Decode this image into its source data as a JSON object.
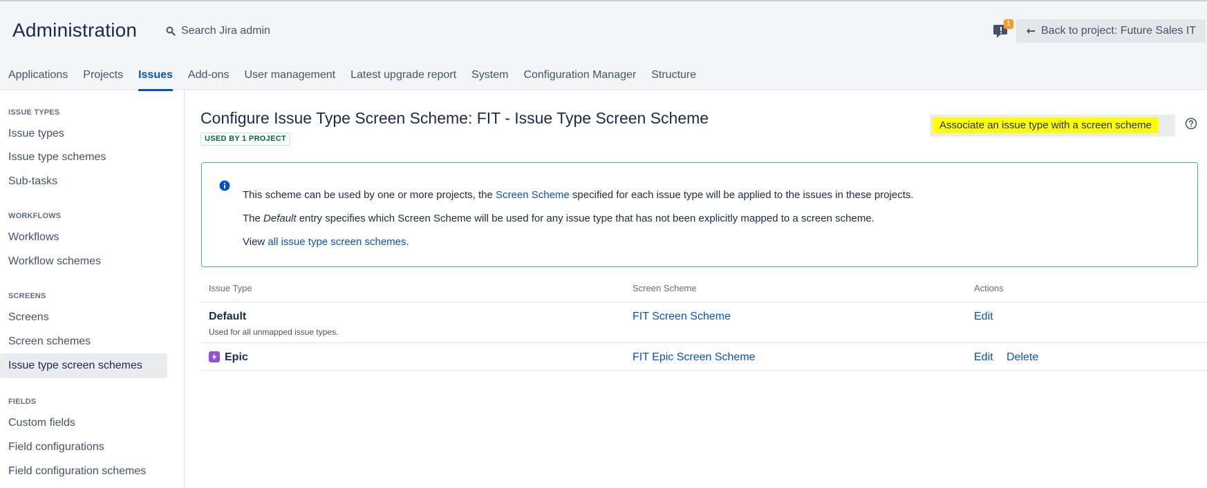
{
  "header": {
    "title": "Administration",
    "search_placeholder": "Search Jira admin",
    "notification_count": "1",
    "back_button_label": "Back to project: Future Sales IT"
  },
  "nav": {
    "tabs": [
      "Applications",
      "Projects",
      "Issues",
      "Add-ons",
      "User management",
      "Latest upgrade report",
      "System",
      "Configuration Manager",
      "Structure"
    ],
    "active": "Issues"
  },
  "sidebar": {
    "sections": [
      {
        "heading": "ISSUE TYPES",
        "items": [
          "Issue types",
          "Issue type schemes",
          "Sub-tasks"
        ]
      },
      {
        "heading": "WORKFLOWS",
        "items": [
          "Workflows",
          "Workflow schemes"
        ]
      },
      {
        "heading": "SCREENS",
        "items": [
          "Screens",
          "Screen schemes",
          "Issue type screen schemes"
        ]
      },
      {
        "heading": "FIELDS",
        "items": [
          "Custom fields",
          "Field configurations",
          "Field configuration schemes"
        ]
      }
    ],
    "selected": "Issue type screen schemes"
  },
  "main": {
    "title": "Configure Issue Type Screen Scheme: FIT - Issue Type Screen Scheme",
    "used_by_lozenge": "USED BY 1 PROJECT",
    "associate_button": "Associate an issue type with a screen scheme",
    "info": {
      "line1_before": "This scheme can be used by one or more projects, the ",
      "line1_link": "Screen Scheme",
      "line1_after": " specified for each issue type will be applied to the issues in these projects.",
      "line2_before": "The ",
      "line2_italic": "Default",
      "line2_after": " entry specifies which Screen Scheme will be used for any issue type that has not been explicitly mapped to a screen scheme.",
      "line3_before": "View ",
      "line3_link": "all issue type screen schemes",
      "line3_after": "."
    },
    "table": {
      "headers": [
        "Issue Type",
        "Screen Scheme",
        "Actions"
      ],
      "rows": [
        {
          "issue_type": "Default",
          "description": "Used for all unmapped issue types.",
          "screen_scheme": "FIT Screen Scheme",
          "actions": [
            "Edit"
          ]
        },
        {
          "issue_type": "Epic",
          "icon": "epic-lightning-icon",
          "screen_scheme": "FIT Epic Screen Scheme",
          "actions": [
            "Edit",
            "Delete"
          ]
        }
      ]
    }
  },
  "colors": {
    "link": "#0052CC",
    "text": "#172B4D",
    "highlight": "#FFFF00",
    "info_border": "#4C9AFF",
    "lozenge_green": "#006644",
    "epic_purple": "#904EE2",
    "badge_orange": "#FF991F"
  }
}
